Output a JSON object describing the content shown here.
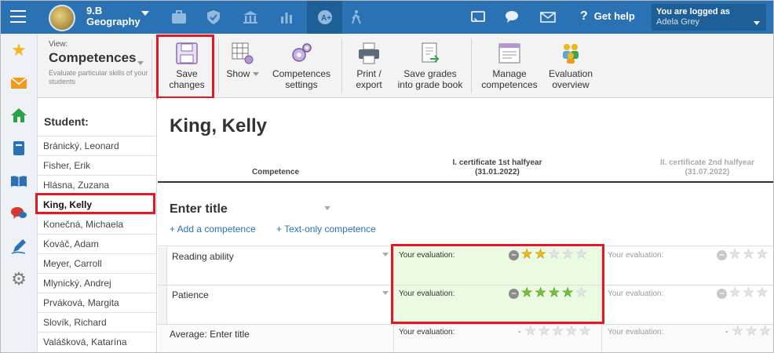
{
  "topbar": {
    "class_line1": "9.B",
    "class_line2": "Geography",
    "help_label": "Get help",
    "logged_as": "You are logged as",
    "user_name": "Adela Grey"
  },
  "toolbar": {
    "view_label": "View:",
    "view_value": "Competences",
    "view_desc": "Evaluate particular skills of your students",
    "buttons": [
      {
        "line1": "Save",
        "line2": "changes"
      },
      {
        "line1": "Show",
        "line2": ""
      },
      {
        "line1": "Competences",
        "line2": "settings"
      },
      {
        "line1": "Print /",
        "line2": "export"
      },
      {
        "line1": "Save grades",
        "line2": "into grade book"
      },
      {
        "line1": "Manage",
        "line2": "competences"
      },
      {
        "line1": "Evaluation",
        "line2": "overview"
      }
    ]
  },
  "students": {
    "header": "Student:",
    "items": [
      "Bránický, Leonard",
      "Fisher, Erik",
      "Hlásna, Zuzana",
      "King, Kelly",
      "Konečná, Michaela",
      "Kováč, Adam",
      "Meyer, Carroll",
      "Mlynický, Andrej",
      "Prváková, Margita",
      "Slovík, Richard",
      "Valášková, Katarína"
    ]
  },
  "main": {
    "student_name": "King, Kelly",
    "col_competence": "Competence",
    "col1_title": "I. certificate 1st halfyear",
    "col1_date": "(31.01.2022)",
    "col2_title": "II. certificate 2nd halfyear",
    "col2_date": "(31.07.2022)",
    "section_title": "Enter title",
    "add_competence": "+ Add a competence",
    "add_text_only": "+ Text-only competence",
    "eval_label": "Your evaluation:",
    "average_label": "Average: Enter title",
    "average_value": "-",
    "rows": [
      {
        "label": "Reading ability",
        "rating": 2,
        "rating_max": 5,
        "star_color": "#f1b81c"
      },
      {
        "label": "Patience",
        "rating": 4,
        "rating_max": 5,
        "star_color": "#76c23b"
      }
    ]
  },
  "colors": {
    "topbar": "#2a72b3",
    "highlight": "#e01a22",
    "accent_link": "#2a72b3",
    "eval_bg": "#eafbe2"
  }
}
